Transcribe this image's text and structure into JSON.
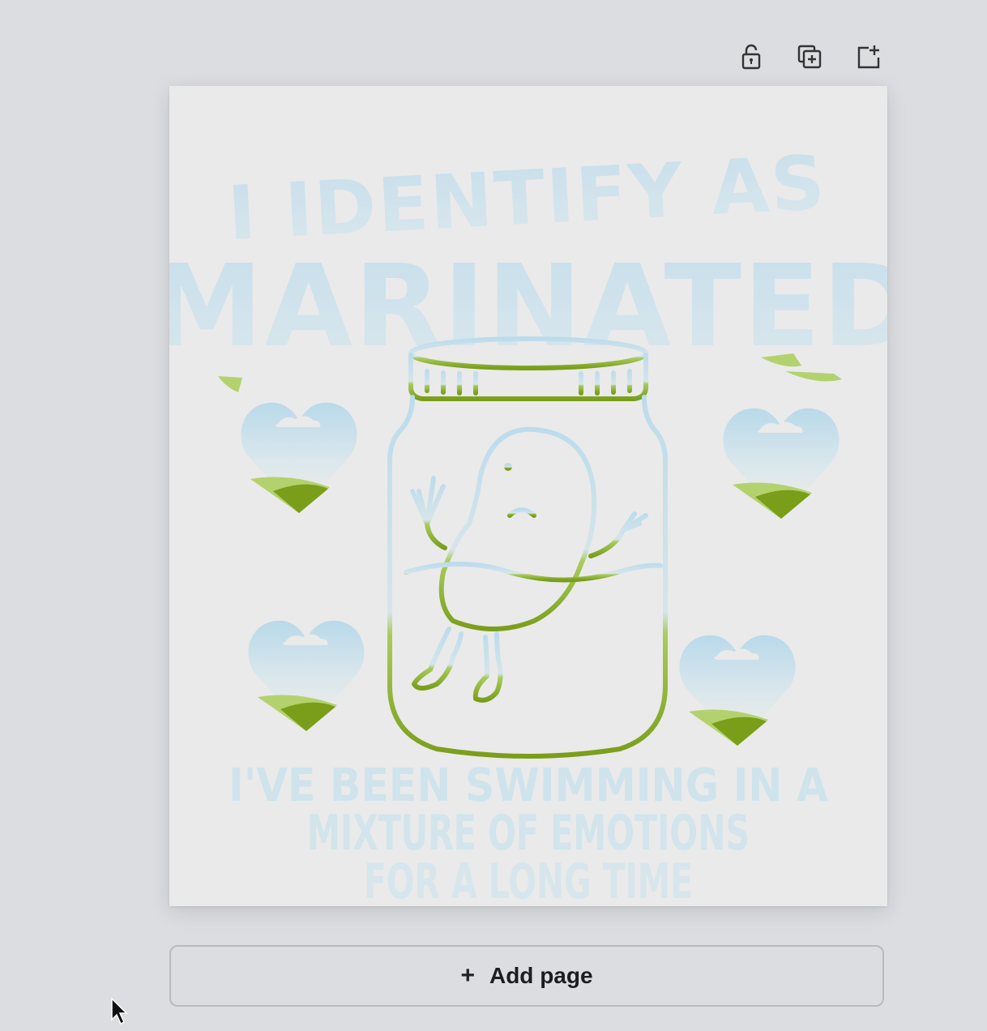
{
  "toolbar": {
    "lock_icon": "lock-open-icon",
    "duplicate_icon": "duplicate-page-icon",
    "add_icon": "add-page-icon"
  },
  "design": {
    "headline_top": "I IDENTIFY AS",
    "headline_main": "MARINATED",
    "tagline_line1": "I'VE BEEN SWIMMING IN A",
    "tagline_line2": "MIXTURE OF EMOTIONS",
    "tagline_line3": "FOR A LONG TIME",
    "colors": {
      "sky": "#bcdcec",
      "grass": "#7a9e1a",
      "grass_light": "#b3d26e",
      "page": "#eaeaea"
    }
  },
  "add_page": {
    "plus": "+",
    "label": "Add page"
  }
}
